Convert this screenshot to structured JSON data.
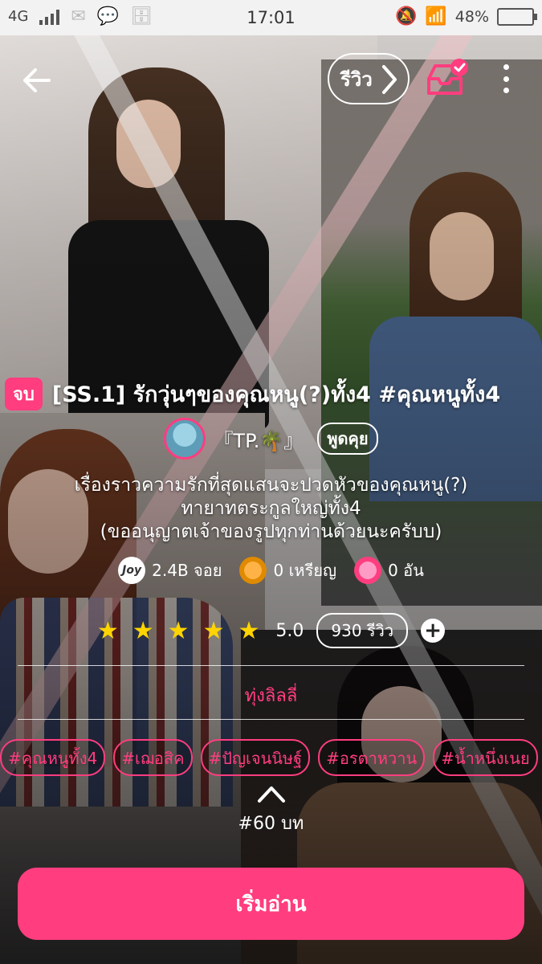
{
  "status_bar": {
    "network": "4G",
    "time": "17:01",
    "battery": "48%",
    "battery_level": 0.48
  },
  "header": {
    "back_icon": "back-arrow-icon",
    "review_label": "รีวิว",
    "library_icon": "library-inbox-check-icon",
    "more_icon": "more-vertical-icon"
  },
  "story": {
    "status_badge": "จบ",
    "title": "[SS.1] รักวุ่นๆของคุณหนู(?)ทั้ง4 #คุณหนูทั้ง4",
    "author": "『TP.🌴』",
    "talk_label": "พูดคุย",
    "description": [
      "เรื่องราวความรักที่สุดแสนจะปวดหัวของคุณหนู(?)",
      "ทายาทตระกูลใหญ่ทั้ง4",
      "(ขออนุญาตเจ้าของรูปทุกท่านด้วยนะครับบ)"
    ],
    "stats": {
      "joy": "2.4B จอย",
      "coins": "0 เหรียญ",
      "candy": "0 อัน",
      "joy_icon_text": "Joy"
    },
    "rating": {
      "stars": 5,
      "value": "5.0",
      "review_count": "930 รีวิว",
      "add_label": "+"
    },
    "group": "ทุ่งลิลลี่",
    "tags": [
      "#คุณหนูทั้ง4",
      "#เฌอสิค",
      "#ปัญเจนนิษฐ์",
      "#อรตาหวาน",
      "#น้ำหนึ่งเนย",
      "#"
    ],
    "chapter_count": "#60 บท"
  },
  "actions": {
    "start_reading": "เริ่มอ่าน"
  },
  "colors": {
    "accent": "#ff3d7f",
    "star": "#ffd400"
  }
}
